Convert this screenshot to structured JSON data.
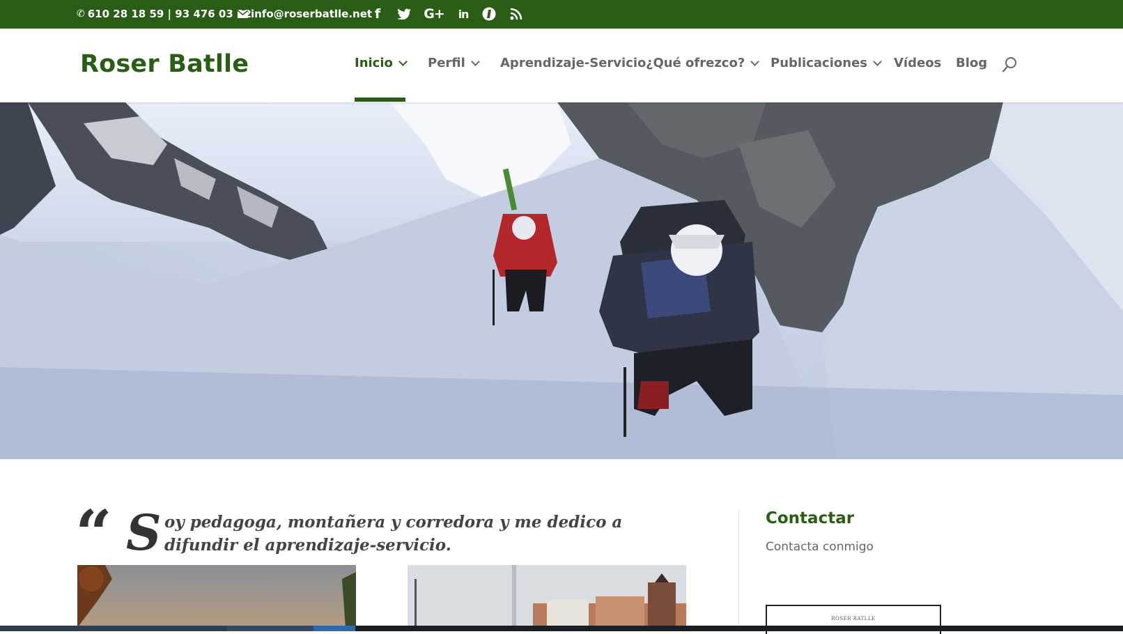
{
  "topbar": {
    "phone": "610 28 18 59 | 93 476 03 12",
    "email": "info@roserbatlle.net",
    "social": [
      "facebook-icon",
      "twitter-icon",
      "google-plus-icon",
      "linkedin-icon",
      "instagram-icon",
      "rss-icon"
    ]
  },
  "colors": {
    "brand_green": "#2a5e17",
    "text_gray": "#666666"
  },
  "header": {
    "logo": "Roser Batlle",
    "nav": [
      {
        "label": "Inicio"
      },
      {
        "label": "Perfil"
      },
      {
        "label": "Aprendizaje-Servicio"
      },
      {
        "label": "¿Qué ofrezco?"
      },
      {
        "label": "Publicaciones"
      },
      {
        "label": "Vídeos"
      },
      {
        "label": "Blog"
      }
    ]
  },
  "hero": {
    "slide_active": 2,
    "slide_count": 5
  },
  "main": {
    "quote_mark": "“",
    "quote_initial": "S",
    "quote_rest": "oy pedagoga, montañera y corredora y me dedico a difundir el aprendizaje-servicio."
  },
  "sidebar": {
    "title": "Contactar",
    "link": "Contacta conmigo",
    "widget_label": "Roser Batlle"
  }
}
